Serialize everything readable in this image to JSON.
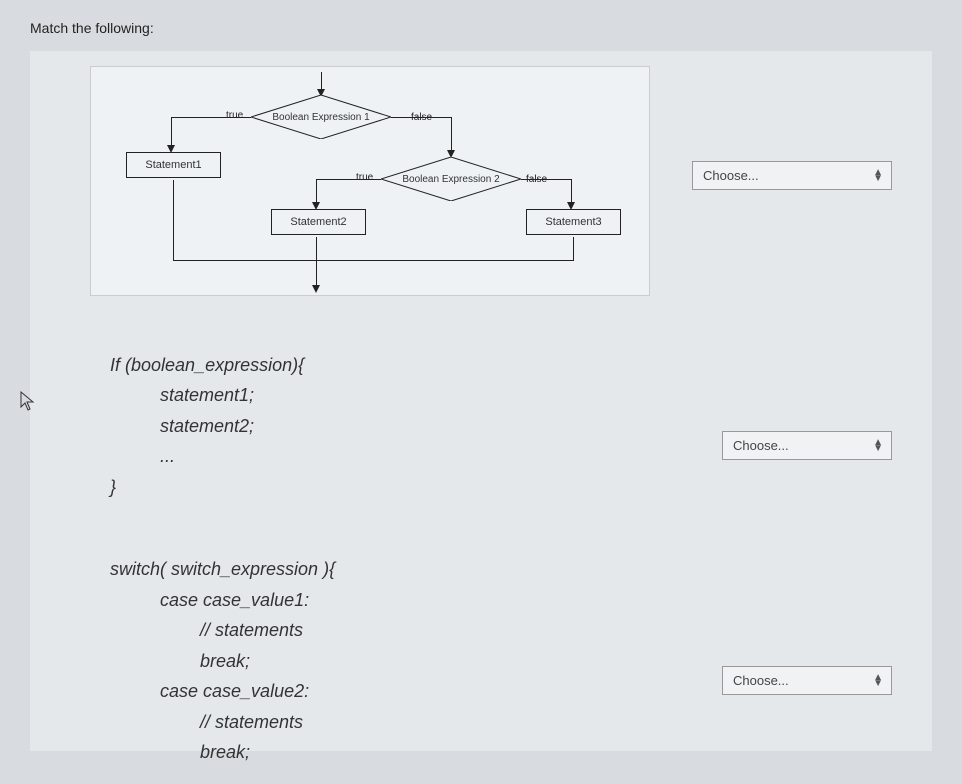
{
  "title": "Match the following:",
  "flowchart": {
    "expr1": "Boolean Expression 1",
    "expr2": "Boolean Expression 2",
    "true_label": "true",
    "false_label": "false",
    "stmt1": "Statement1",
    "stmt2": "Statement2",
    "stmt3": "Statement3"
  },
  "code_if": {
    "l1": "If (boolean_expression){",
    "l2": "statement1;",
    "l3": "statement2;",
    "l4": "...",
    "l5": "}"
  },
  "code_switch": {
    "l1": "switch( switch_expression ){",
    "l2": "case case_value1:",
    "l3": "// statements",
    "l4": "break;",
    "l5": "case case_value2:",
    "l6": "// statements",
    "l7": "break;"
  },
  "dropdown": {
    "placeholder": "Choose..."
  }
}
